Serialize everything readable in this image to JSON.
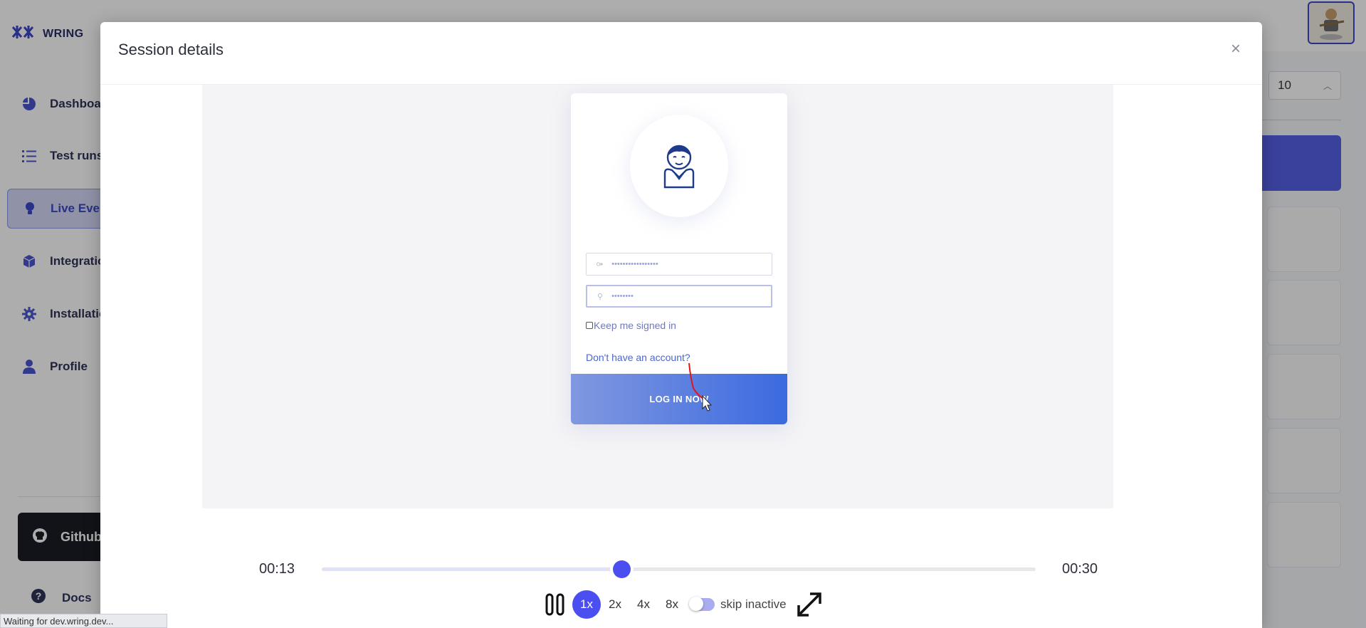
{
  "app": {
    "brand": "WRING"
  },
  "sidebar": {
    "items": [
      {
        "label": "Dashboard",
        "icon": "pie-chart-icon"
      },
      {
        "label": "Test runs",
        "icon": "list-icon"
      },
      {
        "label": "Live Events",
        "icon": "lightbulb-icon"
      },
      {
        "label": "Integrations",
        "icon": "cube-icon"
      },
      {
        "label": "Installation",
        "icon": "gear-icon"
      },
      {
        "label": "Profile",
        "icon": "user-icon"
      }
    ],
    "github_label": "Github",
    "docs_label": "Docs"
  },
  "background": {
    "page_size": "10"
  },
  "modal": {
    "title": "Session details",
    "close": "×"
  },
  "replay": {
    "username_masked": "•••••••••••••••••",
    "password_masked": "••••••••",
    "keep_signed_in": "Keep me signed in",
    "signup_link": "Don't have an account?",
    "login_button": "LOG IN NOW"
  },
  "player": {
    "current_time": "00:13",
    "total_time": "00:30",
    "progress_fraction": 0.42,
    "speeds": [
      "1x",
      "2x",
      "4x",
      "8x"
    ],
    "active_speed": "1x",
    "skip_inactive_label": "skip inactive",
    "accent_color": "#4b4ff0"
  },
  "status_bar": "Waiting for dev.wring.dev..."
}
